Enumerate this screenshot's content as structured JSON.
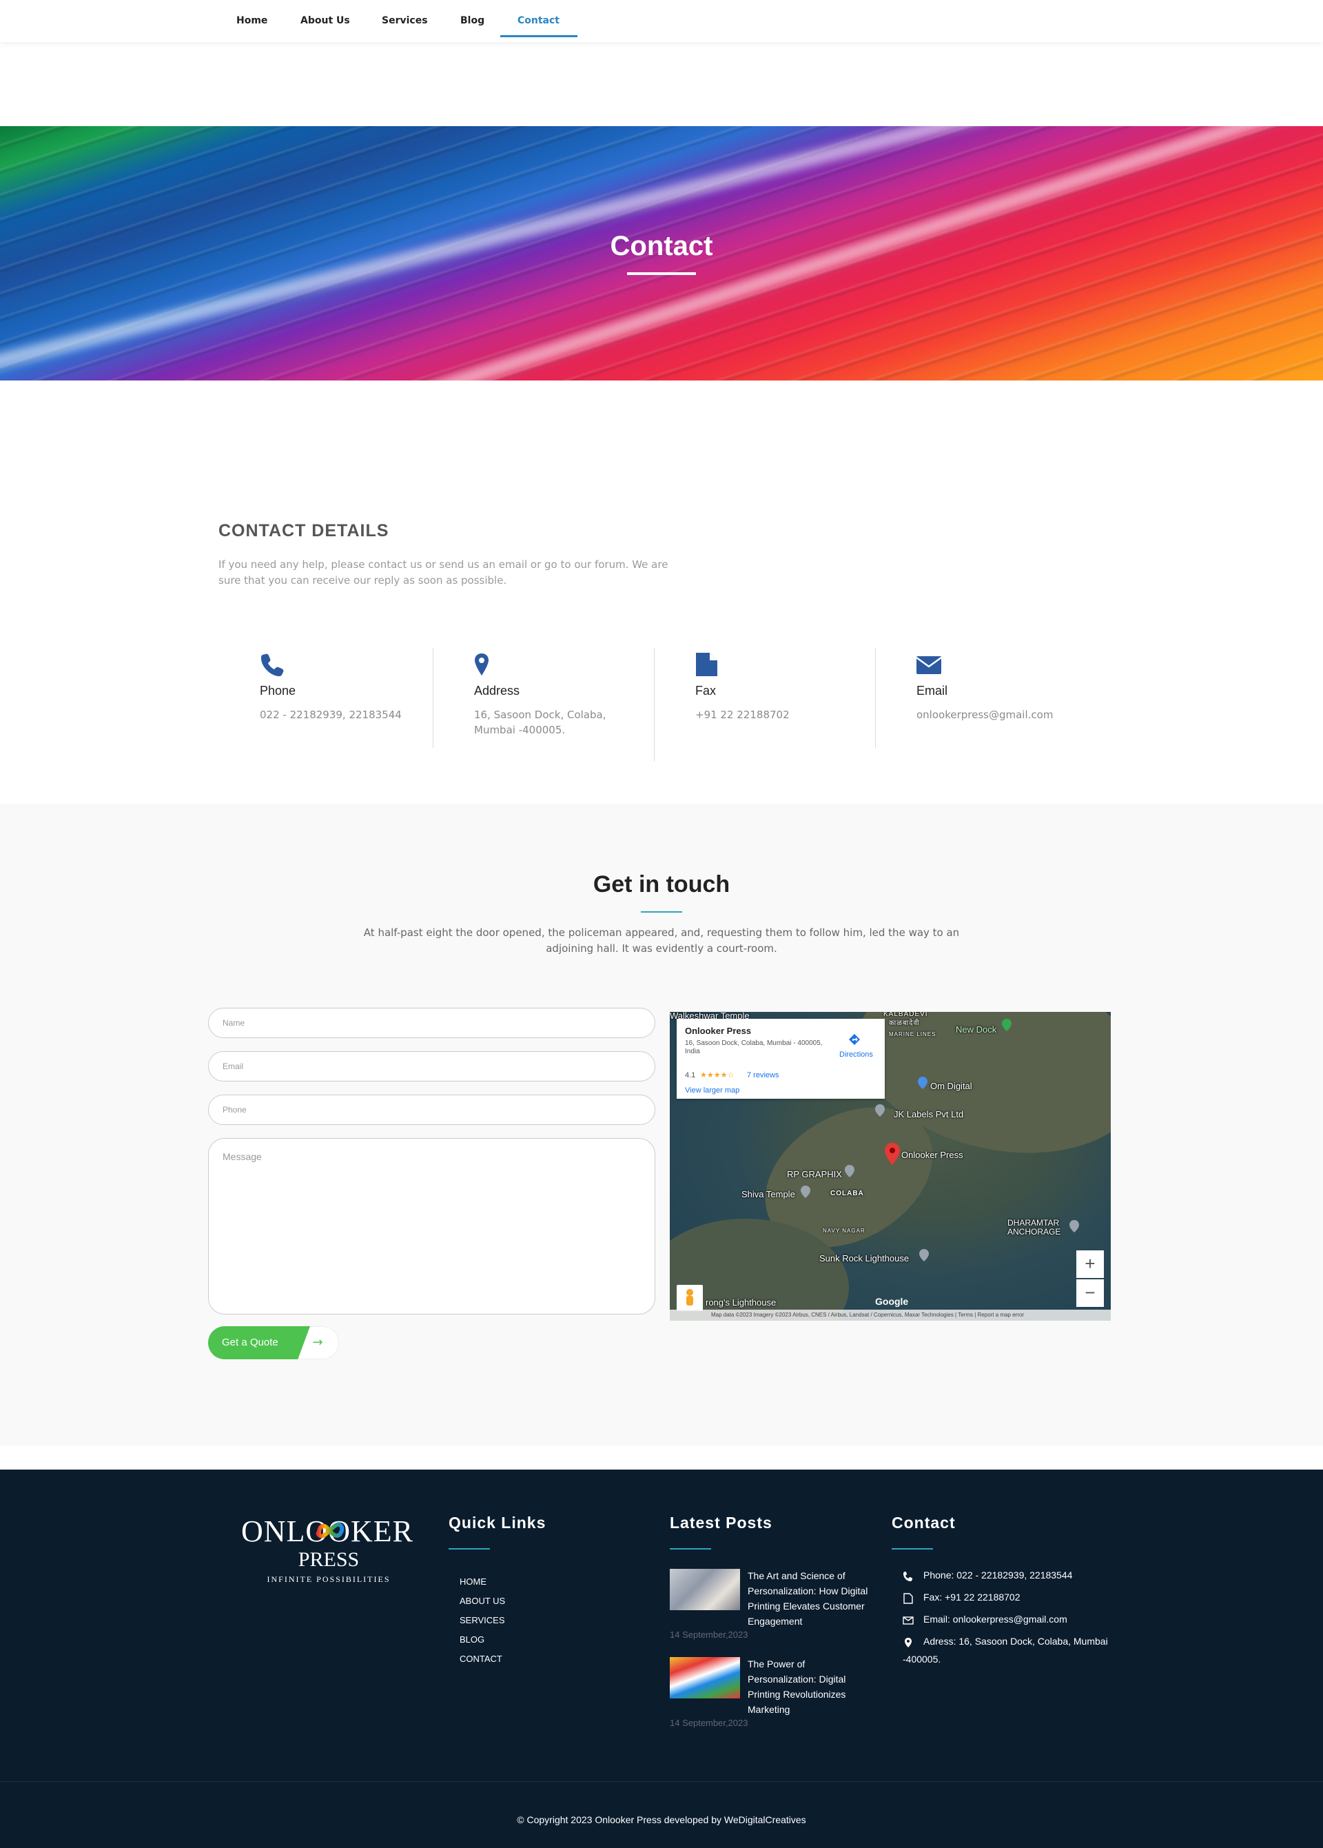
{
  "nav": {
    "items": [
      {
        "label": "Home"
      },
      {
        "label": "About Us"
      },
      {
        "label": "Services"
      },
      {
        "label": "Blog"
      },
      {
        "label": "Contact"
      }
    ],
    "active": "Contact"
  },
  "hero": {
    "title": "Contact"
  },
  "contact_details": {
    "title": "CONTACT DETAILS",
    "description": "If you need any help, please contact us or send us an email or go to our forum. We are sure that you can receive our reply as soon as possible.",
    "cards": [
      {
        "icon": "phone-icon",
        "label": "Phone",
        "value": "022 - 22182939, 22183544"
      },
      {
        "icon": "map-marker-icon",
        "label": "Address",
        "value": "16, Sasoon Dock, Colaba, Mumbai -400005."
      },
      {
        "icon": "document-icon",
        "label": "Fax",
        "value": "+91 22 22188702"
      },
      {
        "icon": "envelope-icon",
        "label": "Email",
        "value": "onlookerpress@gmail.com"
      }
    ]
  },
  "get_in_touch": {
    "title": "Get in touch",
    "description": "At half-past eight the door opened, the policeman appeared, and, requesting them to follow him, led the way to an adjoining hall. It was evidently a court-room.",
    "form": {
      "name_placeholder": "Name",
      "email_placeholder": "Email",
      "phone_placeholder": "Phone",
      "message_placeholder": "Message",
      "submit_label": "Get a Quote",
      "submit_arrow": "→"
    }
  },
  "map": {
    "place_title": "Onlooker Press",
    "place_address": "16, Sasoon Dock, Colaba, Mumbai - 400005, India",
    "rating": "4.1",
    "stars": "★★★★☆",
    "reviews": "7 reviews",
    "larger_map": "View larger map",
    "directions": "Directions",
    "labels": {
      "walkeshwar": "Walkeshwar Temple",
      "kalbadevi": "KALBADEVI",
      "kalbadevi_local": "काळबादेवी",
      "marine_lines": "MARINE LINES",
      "new_dock": "New Dock",
      "om_digital": "Om Digital",
      "jk_labels": "JK Labels Pvt Ltd",
      "onlooker": "Onlooker Press",
      "rp_graphix": "RP GRAPHIX",
      "shiva": "Shiva Temple",
      "colaba": "COLABA",
      "navy_nagar": "NAVY NAGAR",
      "dharamtar": "DHARAMTAR ANCHORAGE",
      "sunk_rock": "Sunk Rock Lighthouse",
      "prongs": "rong's Lighthouse"
    },
    "zoom_in": "+",
    "zoom_out": "−",
    "google": "Google",
    "attribution": "Map data ©2023 Imagery ©2023 Airbus, CNES / Airbus, Landsat / Copernicus, Maxar Technologies | Terms | Report a map error"
  },
  "footer": {
    "logo": {
      "main": "ONLOOKER",
      "sub": "PRESS",
      "tagline": "INFINITE POSSIBILITIES"
    },
    "quick_links": {
      "heading": "Quick Links",
      "items": [
        "HOME",
        "ABOUT US",
        "SERVICES",
        "BLOG",
        "CONTACT"
      ]
    },
    "latest_posts": {
      "heading": "Latest Posts",
      "posts": [
        {
          "title": "The Art and Science of Personalization: How Digital Printing Elevates Customer Engagement",
          "date": "14 September,2023"
        },
        {
          "title": "The Power of Personalization: Digital Printing Revolutionizes Marketing",
          "date": "14 September,2023"
        }
      ]
    },
    "contact": {
      "heading": "Contact",
      "phone": "Phone: 022 - 22182939, 22183544",
      "fax": "Fax: +91 22 22188702",
      "email": "Email: onlookerpress@gmail.com",
      "address": "Adress: 16, Sasoon Dock, Colaba, Mumbai -400005."
    },
    "copyright": "© Copyright 2023 Onlooker Press developed by WeDigitalCreatives"
  },
  "colors": {
    "accent": "#2a86c6",
    "button_green": "#4ec24e",
    "footer_bg": "#0b1c2d",
    "teal_rule": "#2aa7b8"
  }
}
